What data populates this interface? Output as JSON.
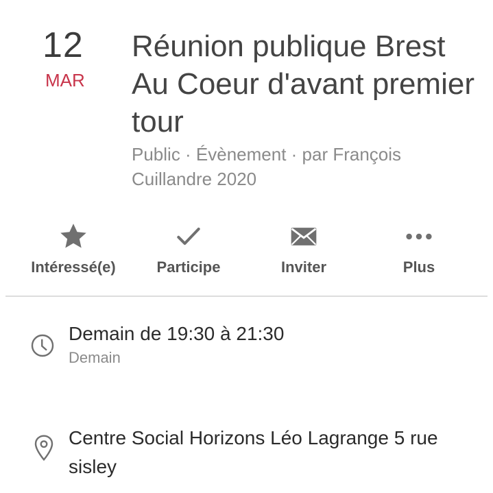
{
  "event": {
    "day": "12",
    "month": "MAR",
    "title": "Réunion publique Brest Au Coeur d'avant premier tour",
    "subtitle": "Public · Évènement · par François Cuillandre 2020"
  },
  "actions": [
    {
      "label": "Intéressé(e)",
      "icon": "star-icon"
    },
    {
      "label": "Participe",
      "icon": "checkmark-icon"
    },
    {
      "label": "Inviter",
      "icon": "envelope-icon"
    },
    {
      "label": "Plus",
      "icon": "more-dots-icon"
    }
  ],
  "details": {
    "time_main": "Demain de 19:30 à 21:30",
    "time_sub": "Demain",
    "location": "Centre Social Horizons Léo Lagrange 5 rue sisley"
  },
  "colors": {
    "accent": "#c8344a",
    "icon_gray": "#707070",
    "text_dark": "#2b2b2b",
    "text_muted": "#8a8a8a"
  }
}
